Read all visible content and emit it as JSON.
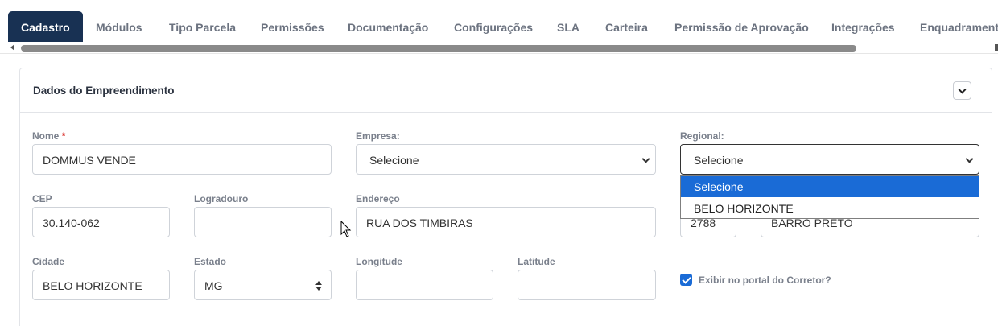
{
  "tabs": [
    {
      "label": "Cadastro",
      "active": true
    },
    {
      "label": "Módulos"
    },
    {
      "label": "Tipo Parcela"
    },
    {
      "label": "Permissões"
    },
    {
      "label": "Documentação"
    },
    {
      "label": "Configurações"
    },
    {
      "label": "SLA"
    },
    {
      "label": "Carteira"
    },
    {
      "label": "Permissão de Aprovação"
    },
    {
      "label": "Integrações"
    },
    {
      "label": "Enquadramento"
    }
  ],
  "card": {
    "title": "Dados do Empreendimento",
    "collapse_icon": "chevron-down-icon"
  },
  "form": {
    "nome": {
      "label": "Nome",
      "required_mark": "*",
      "value": "DOMMUS VENDE"
    },
    "empresa": {
      "label": "Empresa:",
      "value": "Selecione"
    },
    "regional": {
      "label": "Regional:",
      "value": "Selecione",
      "options": [
        "Selecione",
        "BELO HORIZONTE"
      ],
      "highlighted": "Selecione"
    },
    "cep": {
      "label": "CEP",
      "value": "30.140-062"
    },
    "logradouro": {
      "label": "Logradouro",
      "value": ""
    },
    "endereco": {
      "label": "Endereço",
      "value": "RUA DOS TIMBIRAS"
    },
    "numero": {
      "value": "2788"
    },
    "bairro": {
      "value": "BARRO PRETO"
    },
    "cidade": {
      "label": "Cidade",
      "value": "BELO HORIZONTE"
    },
    "estado": {
      "label": "Estado",
      "value": "MG"
    },
    "longitude": {
      "label": "Longitude",
      "value": ""
    },
    "latitude": {
      "label": "Latitude",
      "value": ""
    },
    "exibir_portal": {
      "label": "Exibir no portal do Corretor?",
      "checked": true
    }
  },
  "colors": {
    "active_tab_bg": "#183153",
    "accent_blue": "#1a6bd6",
    "required_red": "#d9302c"
  }
}
